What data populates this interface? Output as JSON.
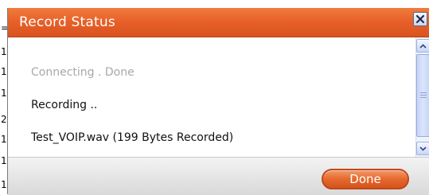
{
  "dialog": {
    "title": "Record Status",
    "close_icon": "close-icon",
    "accent_color": "#e8612a"
  },
  "status_lines": [
    "Connecting . Done",
    "Recording ..",
    "Test_VOIP.wav (199 Bytes Recorded)"
  ],
  "footer": {
    "done_label": "Done"
  },
  "background_window": {
    "edge_chars": [
      "=",
      "1",
      "1",
      "1",
      "2",
      "1",
      "1",
      "1"
    ]
  }
}
